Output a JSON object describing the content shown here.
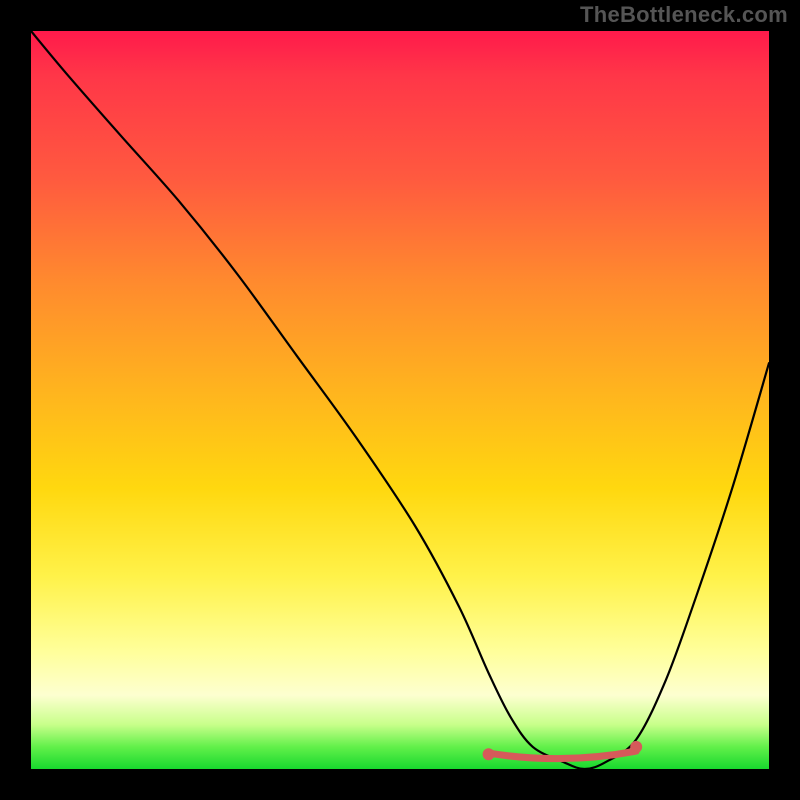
{
  "watermark": "TheBottleneck.com",
  "chart_data": {
    "type": "line",
    "title": "",
    "xlabel": "",
    "ylabel": "",
    "xlim": [
      0,
      100
    ],
    "ylim": [
      0,
      100
    ],
    "grid": false,
    "legend": false,
    "series": [
      {
        "name": "bottleneck-curve",
        "x": [
          0,
          5,
          12,
          20,
          28,
          36,
          44,
          52,
          58,
          62,
          65,
          68,
          72,
          75,
          78,
          82,
          86,
          90,
          95,
          100
        ],
        "y": [
          100,
          94,
          86,
          77,
          67,
          56,
          45,
          33,
          22,
          13,
          7,
          3,
          1,
          0,
          1,
          4,
          12,
          23,
          38,
          55
        ]
      }
    ],
    "flat_region": {
      "x_start": 62,
      "x_end": 82,
      "y": 0.8
    },
    "markers": [
      {
        "x": 62,
        "y": 2
      },
      {
        "x": 82,
        "y": 3
      }
    ],
    "background_gradient": {
      "top": "#ff1a4b",
      "mid": "#ffd80f",
      "bottom": "#18d82e"
    }
  }
}
